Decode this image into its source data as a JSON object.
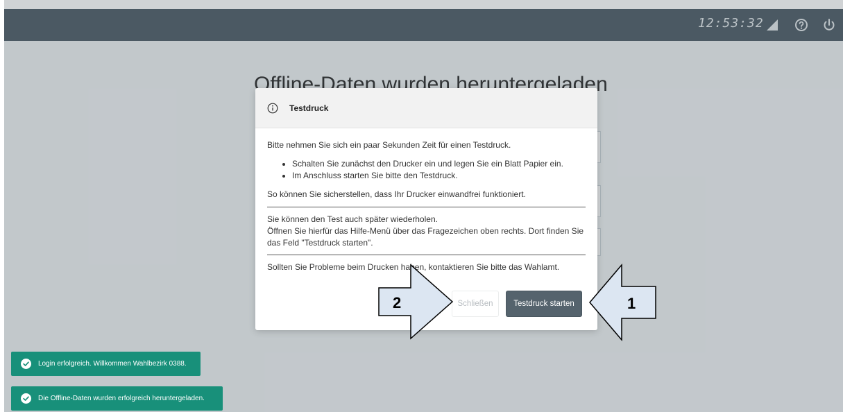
{
  "header": {
    "clock": "12:53:32",
    "icons": [
      "signal-icon",
      "help-icon",
      "power-icon"
    ]
  },
  "background": {
    "title": "Offline-Daten wurden heruntergeladen"
  },
  "dialog": {
    "title": "Testdruck",
    "intro": "Bitte nehmen Sie sich ein paar Sekunden Zeit für einen Testdruck.",
    "bullets": [
      "Schalten Sie zunächst den Drucker ein und legen Sie ein Blatt Papier ein.",
      "Im Anschluss starten Sie bitte den Testdruck."
    ],
    "check_text": "So können Sie sicherstellen, dass Ihr Drucker einwandfrei funktioniert.",
    "later_line1": "Sie können den Test auch später wiederholen.",
    "later_line2": "Öffnen Sie hierfür das Hilfe-Menü über das Fragezeichen oben rechts. Dort finden Sie das Feld \"Testdruck starten\".",
    "problems_text": "Sollten Sie Probleme beim Drucken haben, kontaktieren Sie bitte das Wahlamt.",
    "close_label": "Schließen",
    "start_label": "Testdruck starten"
  },
  "callouts": {
    "left_number": "2",
    "right_number": "1"
  },
  "toasts": [
    "Login erfolgreich. Willkommen Wahlbezirk 0388.",
    "Die Offline-Daten wurden erfolgreich heruntergeladen."
  ],
  "colors": {
    "topbar": "#55636d",
    "primary_button": "#55636d",
    "toast": "#18907a",
    "callout_fill": "#dce6f2"
  }
}
